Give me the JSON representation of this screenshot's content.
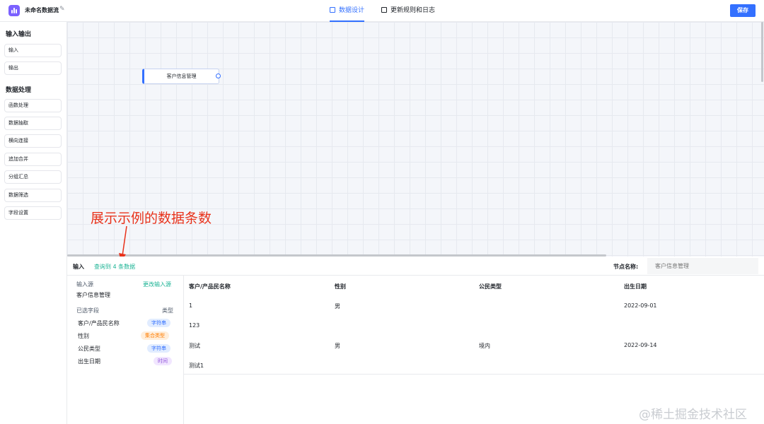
{
  "header": {
    "title": "未命名数据流",
    "tabs": [
      {
        "label": "数据设计",
        "active": true
      },
      {
        "label": "更新规则和日志",
        "active": false
      }
    ],
    "save_label": "保存"
  },
  "sidebar": {
    "sections": [
      {
        "title": "输入输出",
        "items": [
          "输入",
          "输出"
        ]
      },
      {
        "title": "数据处理",
        "items": [
          "函数处理",
          "数据抽取",
          "横向连接",
          "追加合并",
          "分组汇总",
          "数据筛选",
          "字段设置"
        ]
      }
    ]
  },
  "canvas": {
    "node_label": "客户信息管理",
    "annotation": "展示示例的数据条数"
  },
  "bottom": {
    "tab_label": "输入",
    "query_result": "查询到 4 条数据",
    "node_name_label": "节点名称:",
    "node_name_placeholder": "客户信息管理"
  },
  "fields_panel": {
    "source_label": "输入源",
    "change_source": "更改输入源",
    "source_value": "客户信息管理",
    "selected_fields_label": "已选字段",
    "type_label": "类型",
    "fields": [
      {
        "name": "客户/产品民名称",
        "type": "字符串",
        "type_color": "#3370ff",
        "type_bg": "#e1ecff"
      },
      {
        "name": "性别",
        "type": "集合类型",
        "type_color": "#ff7d00",
        "type_bg": "#ffeedb"
      },
      {
        "name": "公民类型",
        "type": "字符串",
        "type_color": "#3370ff",
        "type_bg": "#e1ecff"
      },
      {
        "name": "出生日期",
        "type": "时间",
        "type_color": "#8d4eda",
        "type_bg": "#f1e6ff"
      }
    ]
  },
  "table": {
    "columns": [
      "客户/产品民名称",
      "性别",
      "公民类型",
      "出生日期"
    ],
    "rows": [
      [
        "1",
        "男",
        "",
        "2022-09-01"
      ],
      [
        "123",
        "",
        "",
        ""
      ],
      [
        "测试",
        "男",
        "境内",
        "2022-09-14"
      ],
      [
        "测试1",
        "",
        "",
        ""
      ]
    ]
  },
  "watermark": "@稀土掘金技术社区",
  "colors": {
    "accent": "#3370ff",
    "link": "#1bb394",
    "annotation": "#e8321b"
  }
}
